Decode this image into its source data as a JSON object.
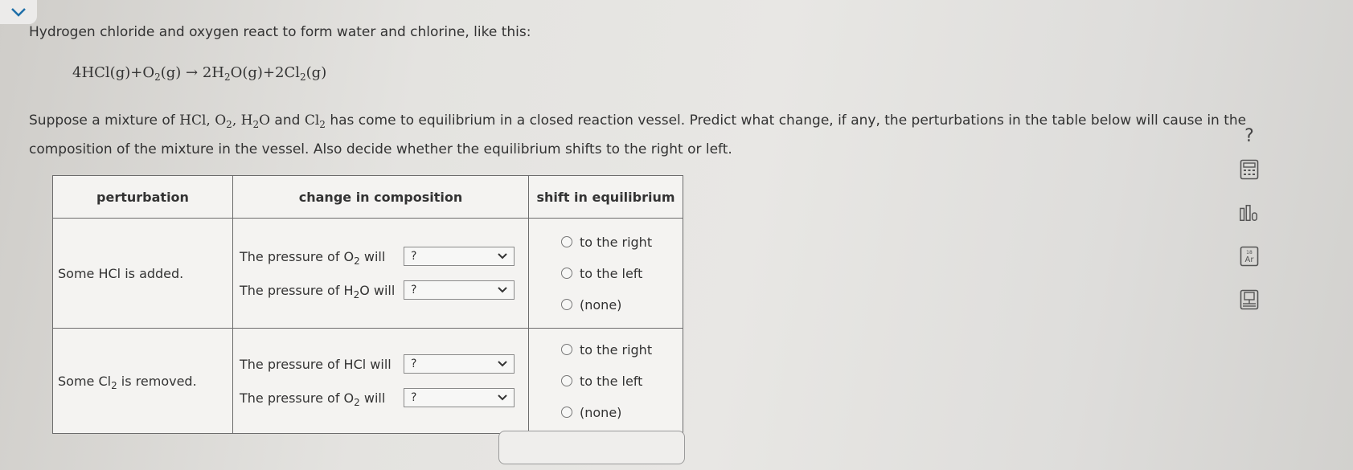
{
  "prompt": "Hydrogen chloride and oxygen react to form water and chlorine, like this:",
  "equation": {
    "p1": "4HCl(g)+O",
    "s1": "2",
    "p2": "(g) → 2H",
    "s2": "2",
    "p3": "O(g)+2Cl",
    "s3": "2",
    "p4": "(g)"
  },
  "question": {
    "t1": "Suppose a mixture of ",
    "t2": "HCl, O",
    "t2s": "2",
    "t3": ", H",
    "t3s": "2",
    "t4": "O",
    "t5": " and ",
    "t6": "Cl",
    "t6s": "2",
    "t7": " has come to equilibrium in a closed reaction vessel. Predict what change, if any, the perturbations in the table below will cause in the composition of the mixture in the vessel. Also decide whether the equilibrium shifts to the right or left."
  },
  "table": {
    "headers": [
      "perturbation",
      "change in composition",
      "shift in equilibrium"
    ],
    "rows": [
      {
        "perturbation": {
          "text": "Some HCl is added.",
          "sub": "",
          "rest": ""
        },
        "changes": [
          {
            "pre": "The pressure of O",
            "sub": "2",
            "post": " will",
            "value": "?"
          },
          {
            "pre": "The pressure of H",
            "sub": "2",
            "post": "O will",
            "value": "?"
          }
        ],
        "options": [
          "to the right",
          "to the left",
          "(none)"
        ]
      },
      {
        "perturbation": {
          "text": "Some Cl",
          "sub": "2",
          "rest": " is removed."
        },
        "changes": [
          {
            "pre": "The pressure of HCl will",
            "sub": "",
            "post": "",
            "value": "?"
          },
          {
            "pre": "The pressure of O",
            "sub": "2",
            "post": " will",
            "value": "?"
          }
        ],
        "options": [
          "to the right",
          "to the left",
          "(none)"
        ]
      }
    ]
  },
  "side_tools": {
    "help": "?",
    "icons": [
      "calculator-icon",
      "bar-chart-icon",
      "periodic-table-icon",
      "reference-icon"
    ]
  },
  "colors": {
    "accent": "#1e6fa8",
    "border": "#6c6c6c"
  }
}
